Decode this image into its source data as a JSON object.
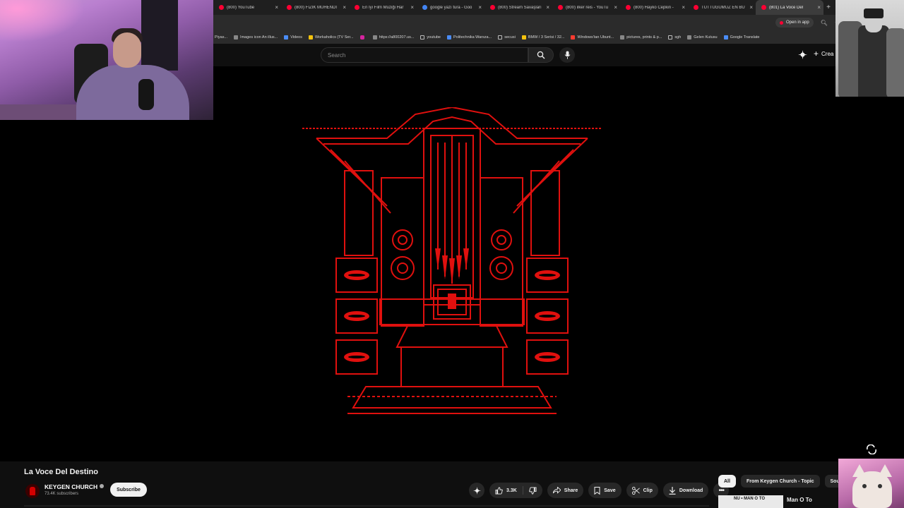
{
  "browser": {
    "tabs": [
      {
        "title": "(800) YouTube",
        "icon": "youtube-icon"
      },
      {
        "title": "(800) FİZİK MÜHENDİ",
        "icon": "youtube-icon"
      },
      {
        "title": "En İyi Film Müziği Har",
        "icon": "youtube-icon"
      },
      {
        "title": "google yazı tura - Goo",
        "icon": "google-icon"
      },
      {
        "title": "(800) Stream Savaşları",
        "icon": "youtube-icon"
      },
      {
        "title": "(800) ilker reis - YouTu",
        "icon": "youtube-icon"
      },
      {
        "title": "(800) Hayko Cepkin -",
        "icon": "youtube-icon"
      },
      {
        "title": "TUTTUĞUMUZ EN BÜ",
        "icon": "youtube-icon"
      },
      {
        "title": "(801) La Voce Del",
        "icon": "youtube-icon",
        "active": true
      }
    ],
    "open_in_app": "Open in app",
    "bookmarks": [
      {
        "label": "Piyas...",
        "icon": "none"
      },
      {
        "label": "Images icon An illus...",
        "icon": "page"
      },
      {
        "label": "Videos",
        "icon": "google"
      },
      {
        "label": "Workaholics (TV Ser...",
        "icon": "yellow"
      },
      {
        "label": "",
        "icon": "instagram"
      },
      {
        "label": "https://a800207.us...",
        "icon": "page"
      },
      {
        "label": "youtube",
        "icon": "folder"
      },
      {
        "label": "Politechnika Warsza...",
        "icon": "blue"
      },
      {
        "label": "secusi",
        "icon": "folder"
      },
      {
        "label": "BMW / 3 Serisi / 32...",
        "icon": "yellow"
      },
      {
        "label": "Windows'tan Ubunt...",
        "icon": "red"
      },
      {
        "label": "pictures, prints & p...",
        "icon": "page"
      },
      {
        "label": "sgh",
        "icon": "folder"
      },
      {
        "label": "Gelen Kutusu",
        "icon": "page"
      },
      {
        "label": "Google Translate",
        "icon": "blue"
      }
    ]
  },
  "masthead": {
    "search_placeholder": "Search",
    "create_label": "Crea"
  },
  "video": {
    "title": "La Voce Del Destino",
    "channel": "KEYGEN CHURCH",
    "subscribers": "73.4K subscribers",
    "subscribe_label": "Subscribe",
    "likes": "3.3K",
    "share_label": "Share",
    "save_label": "Save",
    "clip_label": "Clip",
    "download_label": "Download"
  },
  "sidebar": {
    "chips": [
      {
        "label": "All",
        "active": true
      },
      {
        "label": "From Keygen Church - Topic",
        "active": false
      },
      {
        "label": "Sound",
        "active": false
      }
    ],
    "first_recommendation": {
      "title": "Man O To",
      "thumb_text": "NU • MAN O TO"
    }
  },
  "colors": {
    "accent": "#ff0033",
    "artwork_red": "#e0100e",
    "background": "#0f0f0f"
  }
}
